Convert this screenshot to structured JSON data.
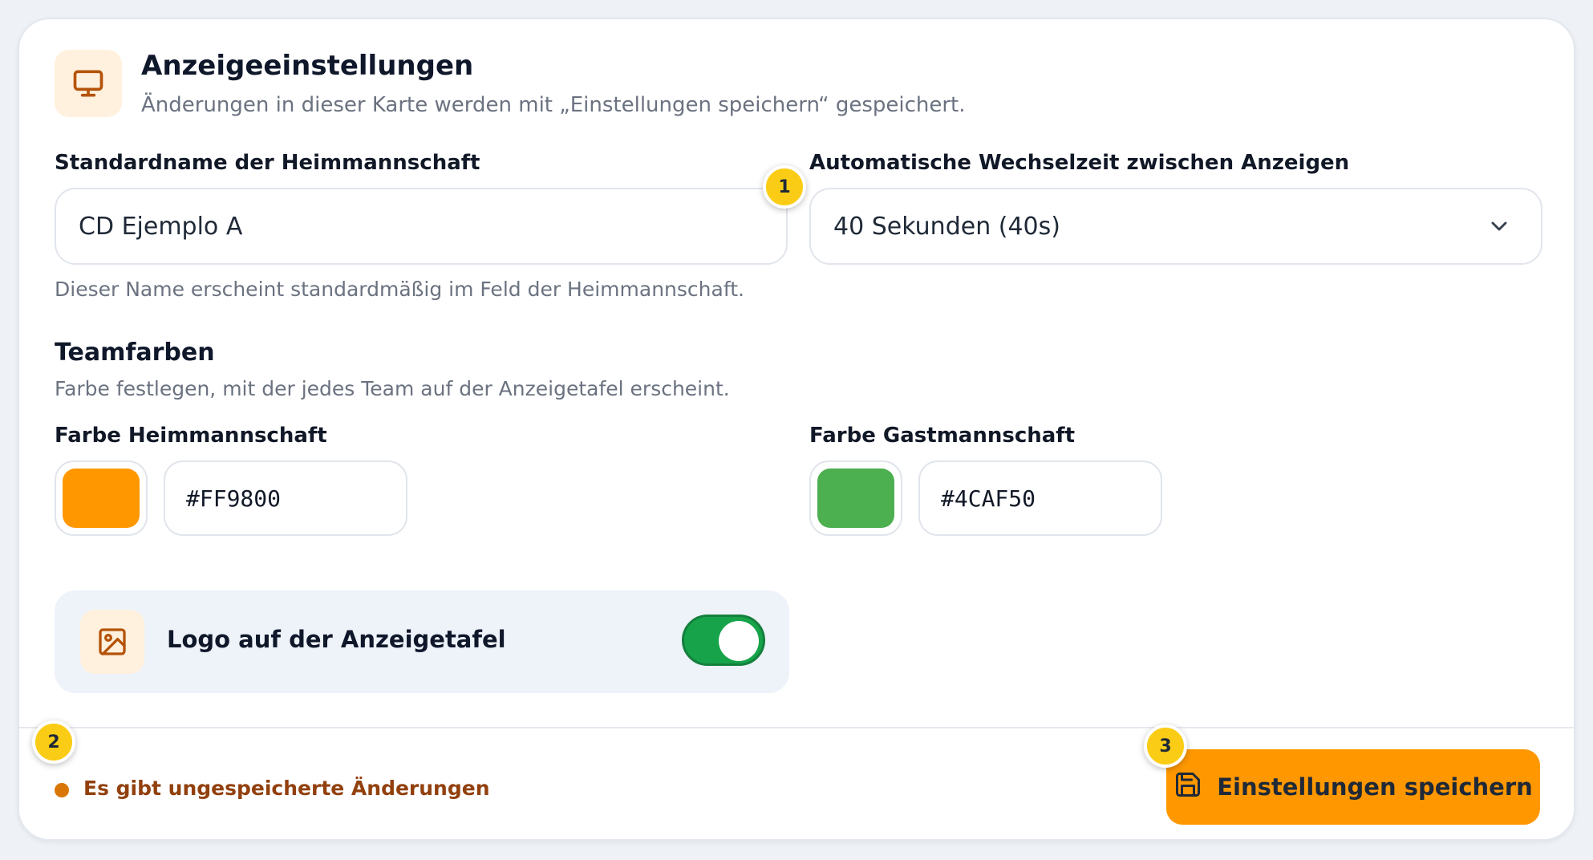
{
  "header": {
    "title": "Anzeigeeinstellungen",
    "subtitle": "Änderungen in dieser Karte werden mit „Einstellungen speichern“ gespeichert.",
    "icon": "monitor-icon"
  },
  "home_team_name": {
    "label": "Standardname der Heimmannschaft",
    "value": "CD Ejemplo A",
    "hint": "Dieser Name erscheint standardmäßig im Feld der Heimmannschaft."
  },
  "rotation": {
    "label": "Automatische Wechselzeit zwischen Anzeigen",
    "selected": "40 Sekunden (40s)"
  },
  "team_colors": {
    "title": "Teamfarben",
    "description": "Farbe festlegen, mit der jedes Team auf der Anzeigetafel erscheint.",
    "home": {
      "label": "Farbe Heimmannschaft",
      "hex": "#FF9800",
      "color": "#FF9800"
    },
    "away": {
      "label": "Farbe Gastmannschaft",
      "hex": "#4CAF50",
      "color": "#4CAF50"
    }
  },
  "logo_toggle": {
    "label": "Logo auf der Anzeigetafel",
    "enabled": true,
    "icon": "image-icon"
  },
  "footer": {
    "status": "Es gibt ungespeicherte Änderungen",
    "save_label": "Einstellungen speichern",
    "save_icon": "save-icon"
  },
  "badges": {
    "one": "1",
    "two": "2",
    "three": "3"
  },
  "colors": {
    "accent": "#FF9800",
    "toggle_on": "#16A34A",
    "badge": "#FACC15"
  }
}
